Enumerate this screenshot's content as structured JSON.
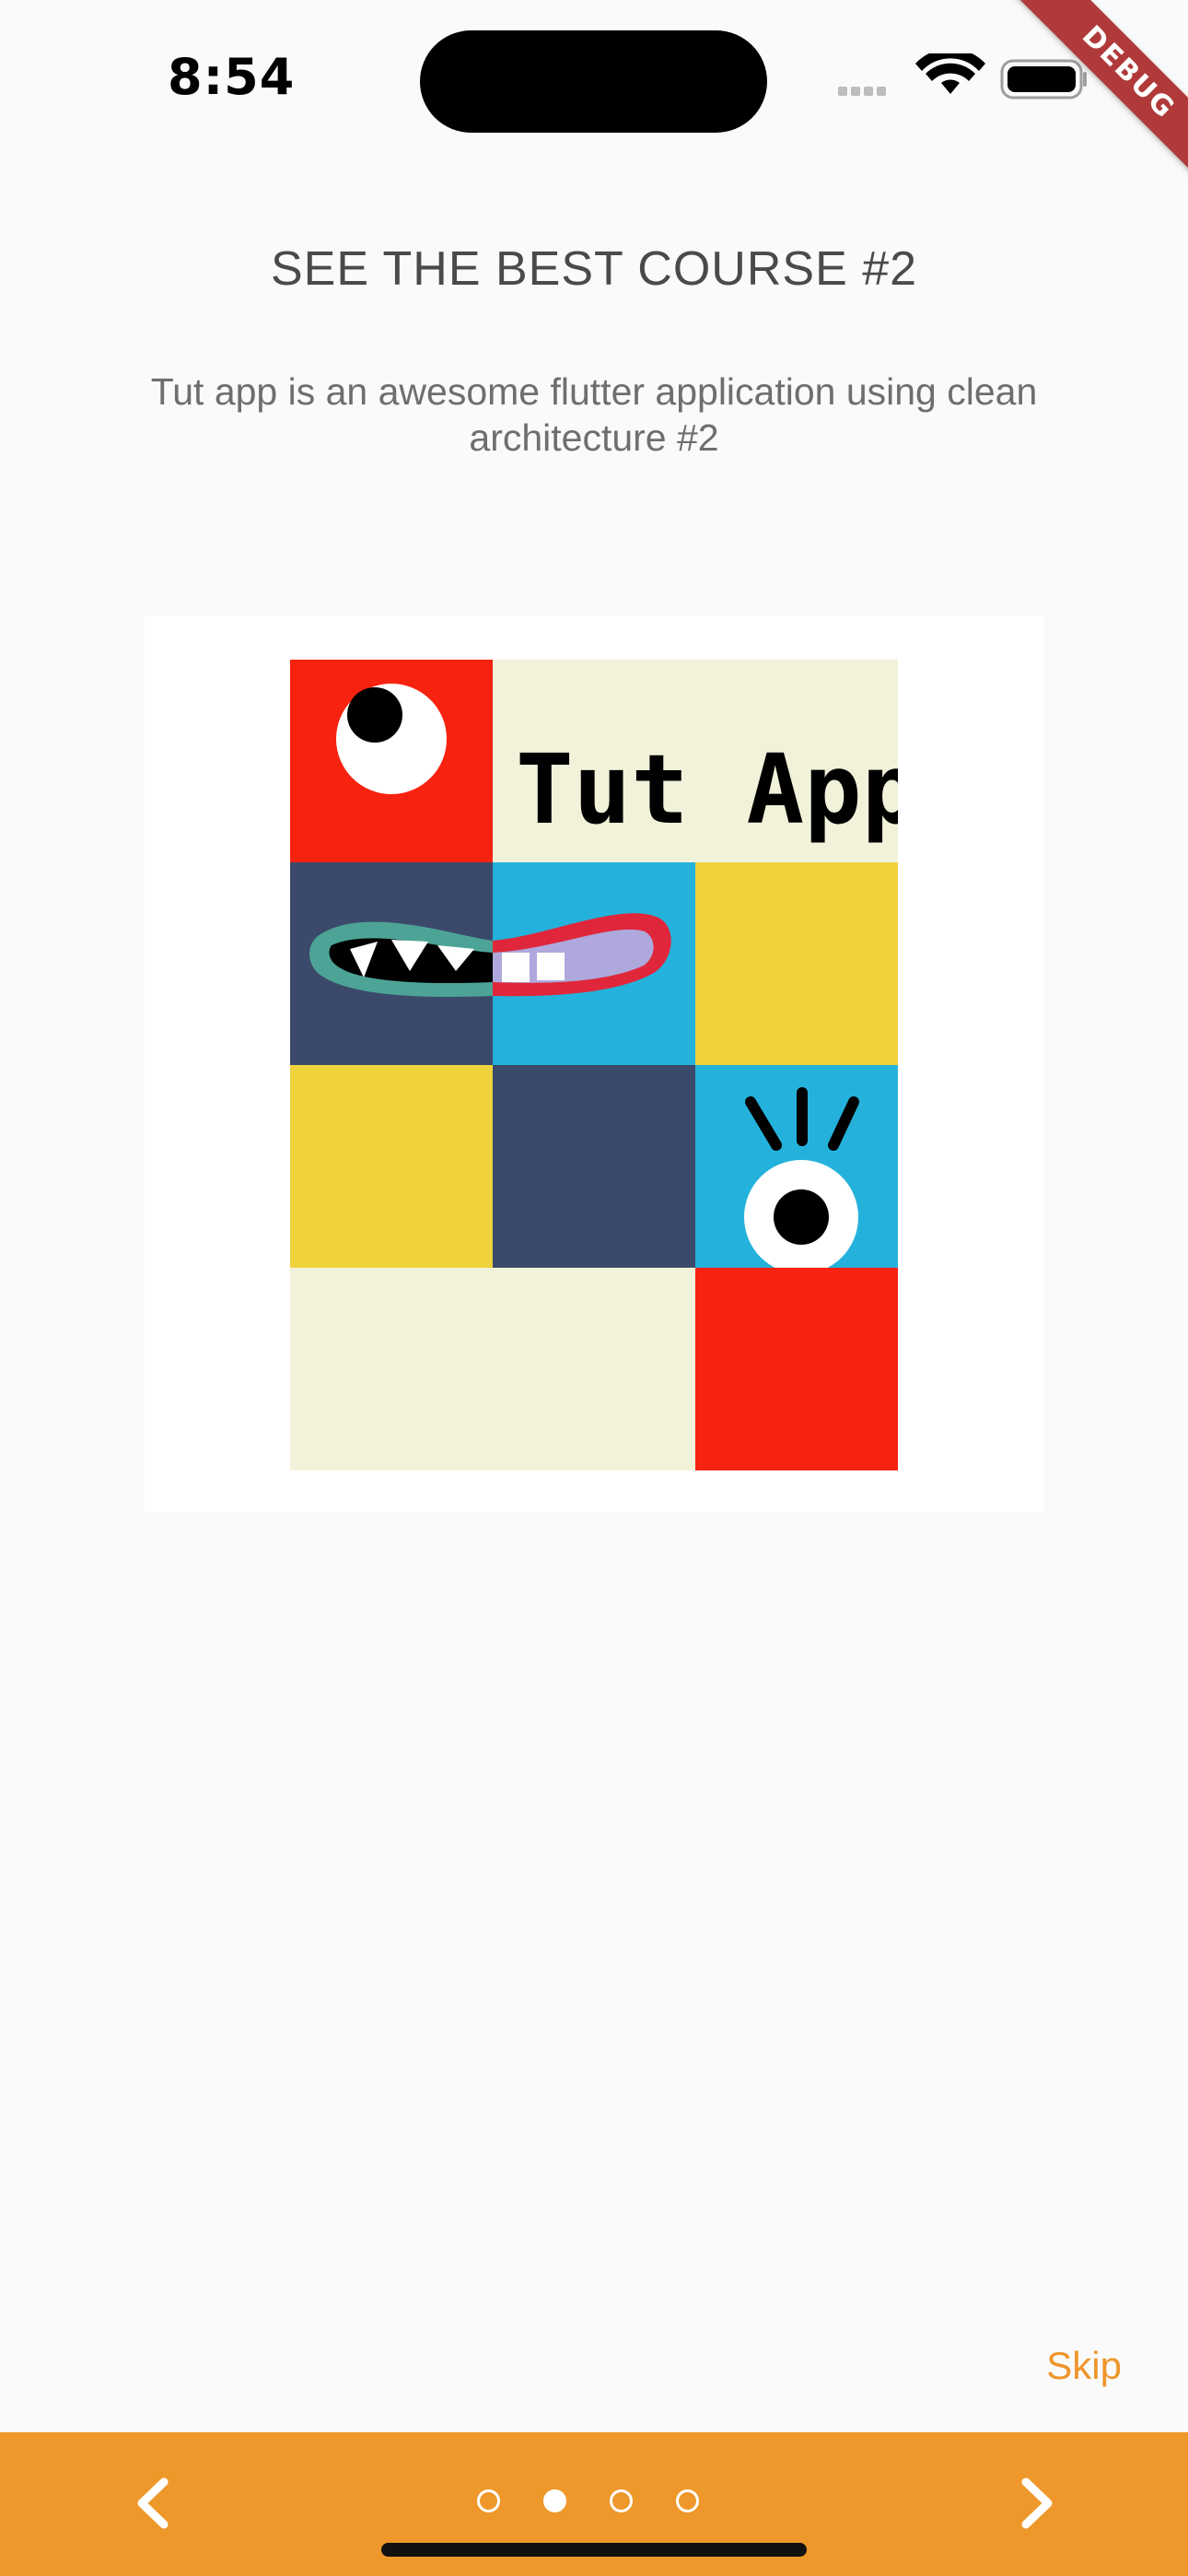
{
  "status_bar": {
    "time": "8:54",
    "icons": [
      "signal-icon",
      "wifi-icon",
      "battery-icon"
    ]
  },
  "debug_banner": "DEBUG",
  "onboarding": {
    "title": "SEE THE BEST COURSE #2",
    "subtitle": "Tut app is an awesome flutter application using clean architecture #2",
    "illustration_text": "Tut App",
    "skip_label": "Skip"
  },
  "navigation": {
    "prev_icon": "chevron-left-icon",
    "next_icon": "chevron-right-icon",
    "page_count": 4,
    "current_page": 2
  },
  "colors": {
    "background": "#fafafa",
    "accent": "#ee982b",
    "title": "#4a4a4a",
    "subtitle": "#6e6e6e",
    "red": "#f7220f",
    "cream": "#f2f2db",
    "navy": "#3b4a6a",
    "cyan": "#24b2dc",
    "yellow": "#efd23c"
  }
}
